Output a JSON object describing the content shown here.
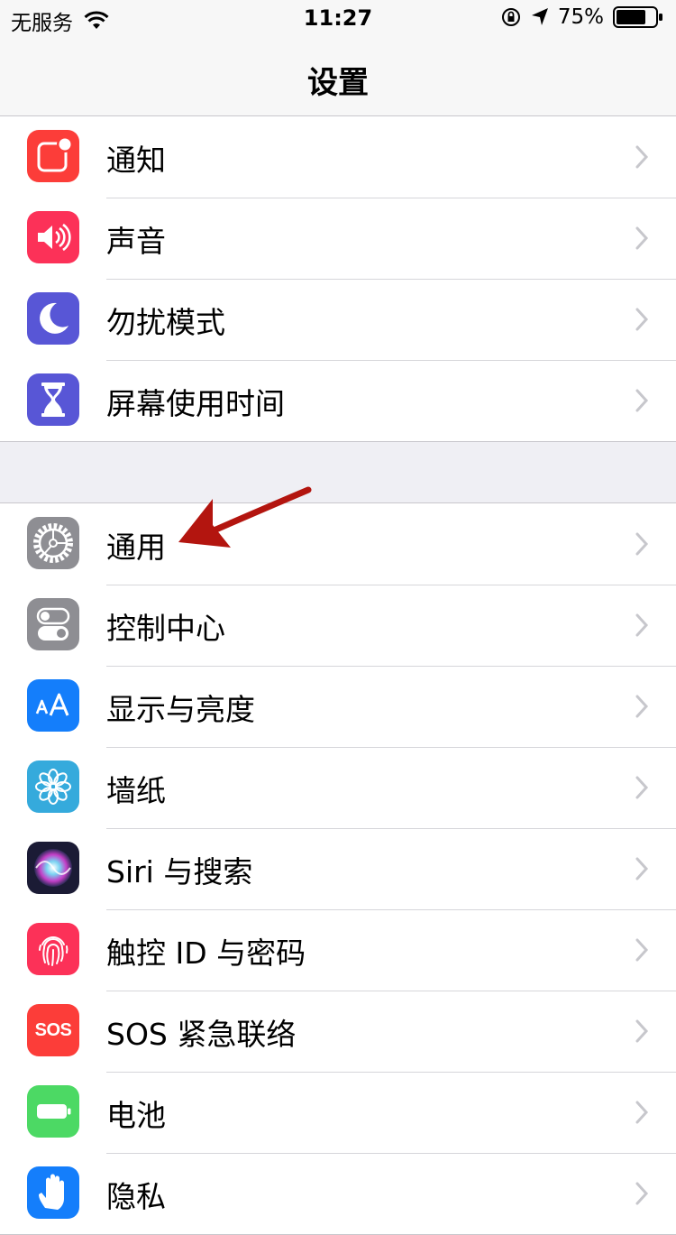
{
  "status_bar": {
    "carrier": "无服务",
    "time": "11:27",
    "battery": "75%"
  },
  "nav": {
    "title": "设置"
  },
  "colors": {
    "group_bg": "#efeff4",
    "annotation_arrow": "#b3150f"
  },
  "groups": [
    {
      "items": [
        {
          "label": "通知",
          "icon": "notifications-icon",
          "color": "#fc3d39"
        },
        {
          "label": "声音",
          "icon": "sounds-icon",
          "color": "#fc3158"
        },
        {
          "label": "勿扰模式",
          "icon": "moon-icon",
          "color": "#5856d6"
        },
        {
          "label": "屏幕使用时间",
          "icon": "hourglass-icon",
          "color": "#5856d6"
        }
      ]
    },
    {
      "items": [
        {
          "label": "通用",
          "icon": "gear-icon",
          "color": "#8e8e93"
        },
        {
          "label": "控制中心",
          "icon": "toggles-icon",
          "color": "#8e8e93"
        },
        {
          "label": "显示与亮度",
          "icon": "text-size-icon",
          "icon_text": "AA",
          "color": "#147efb"
        },
        {
          "label": "墙纸",
          "icon": "flower-icon",
          "color": "#35aadc"
        },
        {
          "label": "Siri 与搜索",
          "icon": "siri-icon",
          "color": "#1b1b35"
        },
        {
          "label": "触控 ID 与密码",
          "icon": "fingerprint-icon",
          "color": "#fc3158"
        },
        {
          "label": "SOS 紧急联络",
          "icon": "sos-icon",
          "icon_text": "SOS",
          "color": "#fc3d39"
        },
        {
          "label": "电池",
          "icon": "battery-icon",
          "color": "#4cd964"
        },
        {
          "label": "隐私",
          "icon": "hand-icon",
          "color": "#147efb"
        }
      ]
    }
  ]
}
